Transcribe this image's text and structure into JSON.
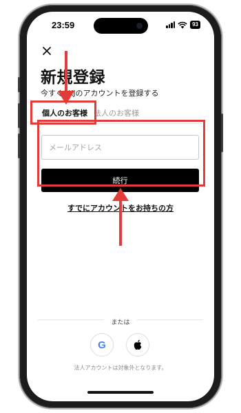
{
  "status_bar": {
    "time": "23:59",
    "battery": "93"
  },
  "page": {
    "title": "新規登録",
    "subtitle": "今すぐSKJのアカウントを登録する"
  },
  "tabs": [
    {
      "label": "個人のお客様"
    },
    {
      "label": "法人のお客様"
    }
  ],
  "form": {
    "email_placeholder": "メールアドレス",
    "email_value": "",
    "continue_label": "続行"
  },
  "existing_account_link": "すでにアカウントをお持ちの方",
  "divider_label": "または",
  "social": {
    "google_label": "G"
  },
  "footnote": "法人アカウントは対象外となります。",
  "colors": {
    "annotation": "#e23c38",
    "primary_button": "#000000",
    "google_blue": "#4285F4"
  }
}
